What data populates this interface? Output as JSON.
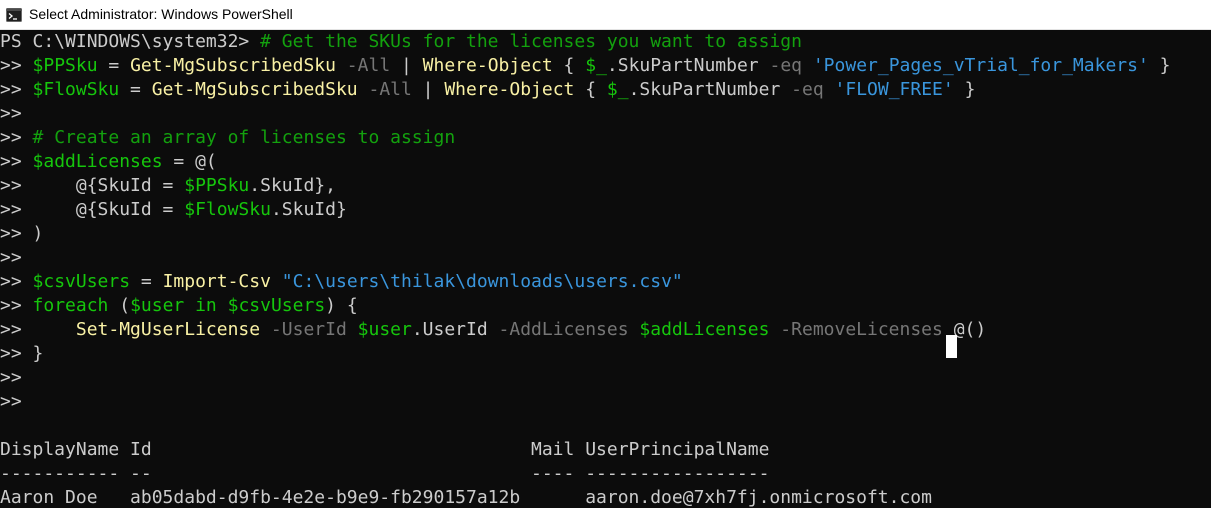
{
  "window": {
    "title": "Select Administrator: Windows PowerShell"
  },
  "icons": {
    "app_icon": "powershell-icon"
  },
  "colors": {
    "background": "#0c0c0c",
    "text": "#cccccc",
    "comment": "#13a10e",
    "variable": "#16c60c",
    "command": "#f9f1a5",
    "parameter": "#767676",
    "string": "#3a96dd"
  },
  "console": {
    "lines": [
      {
        "segments": [
          {
            "text": "PS C:\\WINDOWS\\system32> ",
            "type": "norm"
          },
          {
            "text": "# Get the SKUs for the licenses you want to assign",
            "type": "com"
          }
        ]
      },
      {
        "segments": [
          {
            "text": ">> ",
            "type": "norm"
          },
          {
            "text": "$PPSku",
            "type": "var"
          },
          {
            "text": " = ",
            "type": "op"
          },
          {
            "text": "Get-MgSubscribedSku",
            "type": "cmd"
          },
          {
            "text": " -All",
            "type": "par"
          },
          {
            "text": " | ",
            "type": "op"
          },
          {
            "text": "Where-Object",
            "type": "cmd"
          },
          {
            "text": " { ",
            "type": "norm"
          },
          {
            "text": "$_",
            "type": "var"
          },
          {
            "text": ".SkuPartNumber",
            "type": "norm"
          },
          {
            "text": " -eq",
            "type": "par"
          },
          {
            "text": " ",
            "type": "norm"
          },
          {
            "text": "'Power_Pages_vTrial_for_Makers'",
            "type": "str"
          },
          {
            "text": " }",
            "type": "norm"
          }
        ]
      },
      {
        "segments": [
          {
            "text": ">> ",
            "type": "norm"
          },
          {
            "text": "$FlowSku",
            "type": "var"
          },
          {
            "text": " = ",
            "type": "op"
          },
          {
            "text": "Get-MgSubscribedSku",
            "type": "cmd"
          },
          {
            "text": " -All",
            "type": "par"
          },
          {
            "text": " | ",
            "type": "op"
          },
          {
            "text": "Where-Object",
            "type": "cmd"
          },
          {
            "text": " { ",
            "type": "norm"
          },
          {
            "text": "$_",
            "type": "var"
          },
          {
            "text": ".SkuPartNumber",
            "type": "norm"
          },
          {
            "text": " -eq",
            "type": "par"
          },
          {
            "text": " ",
            "type": "norm"
          },
          {
            "text": "'FLOW_FREE'",
            "type": "str"
          },
          {
            "text": " }",
            "type": "norm"
          }
        ]
      },
      {
        "segments": [
          {
            "text": ">>",
            "type": "norm"
          }
        ]
      },
      {
        "segments": [
          {
            "text": ">> ",
            "type": "norm"
          },
          {
            "text": "# Create an array of licenses to assign",
            "type": "com"
          }
        ]
      },
      {
        "segments": [
          {
            "text": ">> ",
            "type": "norm"
          },
          {
            "text": "$addLicenses",
            "type": "var"
          },
          {
            "text": " = @(",
            "type": "op"
          }
        ]
      },
      {
        "segments": [
          {
            "text": ">>     @{SkuId = ",
            "type": "norm"
          },
          {
            "text": "$PPSku",
            "type": "var"
          },
          {
            "text": ".SkuId},",
            "type": "norm"
          }
        ]
      },
      {
        "segments": [
          {
            "text": ">>     @{SkuId = ",
            "type": "norm"
          },
          {
            "text": "$FlowSku",
            "type": "var"
          },
          {
            "text": ".SkuId}",
            "type": "norm"
          }
        ]
      },
      {
        "segments": [
          {
            "text": ">> )",
            "type": "norm"
          }
        ]
      },
      {
        "segments": [
          {
            "text": ">>",
            "type": "norm"
          }
        ]
      },
      {
        "segments": [
          {
            "text": ">> ",
            "type": "norm"
          },
          {
            "text": "$csvUsers",
            "type": "var"
          },
          {
            "text": " = ",
            "type": "op"
          },
          {
            "text": "Import-Csv",
            "type": "cmd"
          },
          {
            "text": " ",
            "type": "norm"
          },
          {
            "text": "\"C:\\users\\thilak\\downloads\\users.csv\"",
            "type": "str"
          }
        ]
      },
      {
        "segments": [
          {
            "text": ">> ",
            "type": "norm"
          },
          {
            "text": "foreach",
            "type": "var"
          },
          {
            "text": " (",
            "type": "norm"
          },
          {
            "text": "$user",
            "type": "var"
          },
          {
            "text": " ",
            "type": "norm"
          },
          {
            "text": "in",
            "type": "var"
          },
          {
            "text": " ",
            "type": "norm"
          },
          {
            "text": "$csvUsers",
            "type": "var"
          },
          {
            "text": ") {",
            "type": "norm"
          }
        ]
      },
      {
        "segments": [
          {
            "text": ">>     ",
            "type": "norm"
          },
          {
            "text": "Set-MgUserLicense",
            "type": "cmd"
          },
          {
            "text": " -UserId",
            "type": "par"
          },
          {
            "text": " ",
            "type": "norm"
          },
          {
            "text": "$user",
            "type": "var"
          },
          {
            "text": ".UserId",
            "type": "norm"
          },
          {
            "text": " -AddLicenses",
            "type": "par"
          },
          {
            "text": " ",
            "type": "norm"
          },
          {
            "text": "$addLicenses",
            "type": "var"
          },
          {
            "text": " -RemoveLicenses",
            "type": "par"
          },
          {
            "text": " @()",
            "type": "norm"
          }
        ]
      },
      {
        "segments": [
          {
            "text": ">> }",
            "type": "norm"
          }
        ]
      },
      {
        "segments": [
          {
            "text": ">>",
            "type": "norm"
          }
        ]
      },
      {
        "segments": [
          {
            "text": ">>",
            "type": "norm"
          }
        ]
      },
      {
        "segments": [
          {
            "text": "",
            "type": "norm"
          }
        ]
      },
      {
        "segments": [
          {
            "text": "DisplayName Id                                   Mail UserPrincipalName",
            "type": "norm"
          }
        ]
      },
      {
        "segments": [
          {
            "text": "----------- --                                   ---- -----------------",
            "type": "norm"
          }
        ]
      },
      {
        "segments": [
          {
            "text": "Aaron Doe   ab05dabd-d9fb-4e2e-b9e9-fb290157a12b      aaron.doe@7xh7fj.onmicrosoft.com",
            "type": "norm"
          }
        ]
      }
    ]
  }
}
